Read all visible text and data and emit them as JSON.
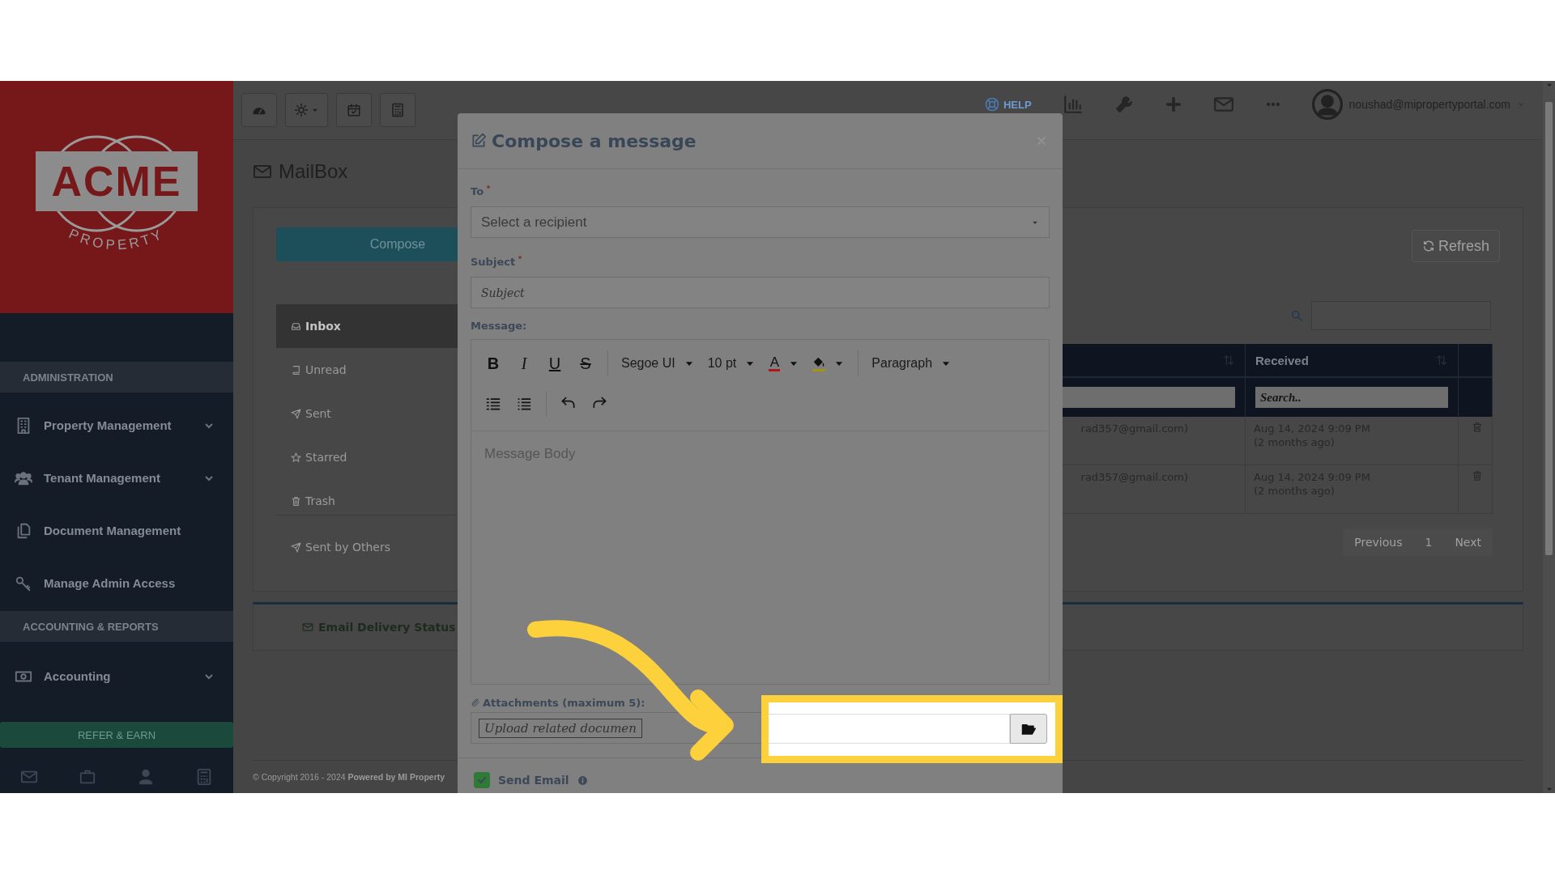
{
  "sidebar": {
    "logo": {
      "wordmark": "ACME",
      "tagline": "PROPERTY"
    },
    "sections": [
      {
        "title": "ADMINISTRATION",
        "items": [
          {
            "label": "Property Management",
            "kind": "building",
            "expandable": true
          },
          {
            "label": "Tenant Management",
            "kind": "users",
            "expandable": true
          },
          {
            "label": "Document Management",
            "kind": "documents",
            "expandable": false
          },
          {
            "label": "Manage Admin Access",
            "kind": "key",
            "expandable": false
          }
        ]
      },
      {
        "title": "ACCOUNTING & REPORTS",
        "items": [
          {
            "label": "Accounting",
            "kind": "money",
            "expandable": true
          }
        ]
      }
    ],
    "refer_button": "REFER & EARN"
  },
  "top_bar": {
    "help": "HELP",
    "user_email": "noushad@mipropertyportal.com"
  },
  "mailbox": {
    "title": "MailBox",
    "compose_button": "Compose",
    "folders": [
      {
        "label": "Inbox",
        "kind": "inbox",
        "selected": true
      },
      {
        "label": "Unread",
        "kind": "book",
        "selected": false
      },
      {
        "label": "Sent",
        "kind": "send",
        "selected": false
      },
      {
        "label": "Starred",
        "kind": "star",
        "selected": false
      },
      {
        "label": "Trash",
        "kind": "trash",
        "selected": false
      }
    ],
    "other_folders": [
      {
        "label": "Sent by Others",
        "kind": "send",
        "selected": false
      }
    ],
    "delivery_status": "Email Delivery Status",
    "refresh_button": "Refresh",
    "table": {
      "received_heading": "Received",
      "received_filter_placeholder": "Search..",
      "rows": [
        {
          "sender": "rad357@gmail.com)",
          "received": "Aug 14, 2024 9:09 PM",
          "ago": "(2 months ago)"
        },
        {
          "sender": "rad357@gmail.com)",
          "received": "Aug 14, 2024 9:09 PM",
          "ago": "(2 months ago)"
        }
      ]
    },
    "pagination": {
      "previous": "Previous",
      "page": "1",
      "next": "Next"
    }
  },
  "footer": "© Copyright 2016 - 2024 **Powered by MI Property**",
  "modal": {
    "title": "Compose a message",
    "to": {
      "label": "To",
      "required": true,
      "placeholder": "Select a recipient"
    },
    "subject": {
      "label": "Subject",
      "required": true,
      "placeholder": "Subject"
    },
    "message": {
      "label": "Message:",
      "format_buttons": [
        {
          "kind": "bold",
          "glyph": "B"
        },
        {
          "kind": "italic",
          "glyph": "I"
        },
        {
          "kind": "underline",
          "glyph": "U"
        },
        {
          "kind": "strike",
          "glyph": "S"
        }
      ],
      "font": "Segoe UI",
      "size": "10 pt",
      "text_color_glyph": "A",
      "block_format": "Paragraph",
      "placeholder": "Message Body"
    },
    "attachments": {
      "label": "Attachments (maximum 5):",
      "upload_text": "Upload related documen"
    },
    "send_email": {
      "label": "Send Email",
      "checked": true
    }
  }
}
